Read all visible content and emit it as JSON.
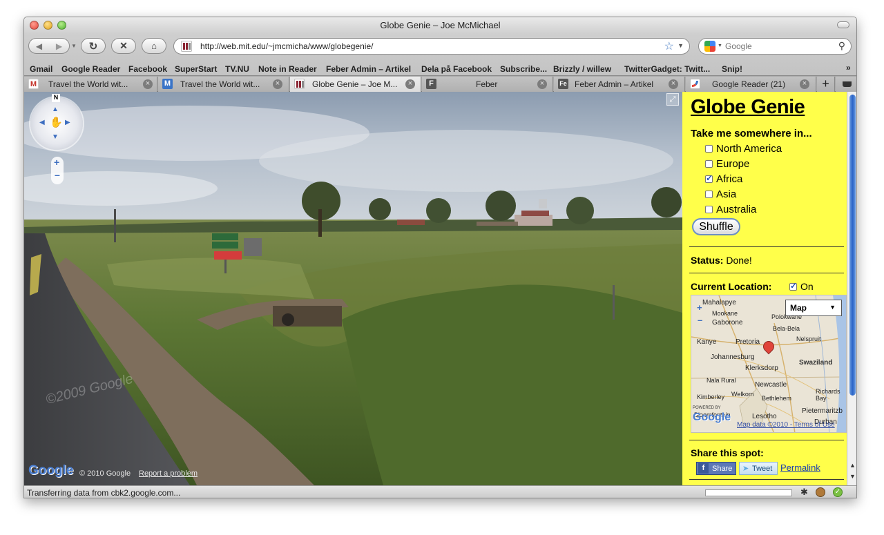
{
  "window": {
    "title": "Globe Genie – Joe McMichael"
  },
  "toolbar": {
    "url": "http://web.mit.edu/~jmcmicha/www/globegenie/",
    "search_placeholder": "Google"
  },
  "bookmarks": [
    "Gmail",
    "Google Reader",
    "Facebook",
    "SuperStart",
    "TV.NU",
    "Note in Reader",
    "Feber Admin – Artikel",
    "Dela på Facebook",
    "Subscribe...",
    "Brizzly / willew",
    "TwitterGadget: Twitt...",
    "Snip!"
  ],
  "tabs": [
    {
      "label": "Travel the World wit...",
      "icon": "gmail-icon",
      "icon_text": "M",
      "color": "#c5352c",
      "active": false
    },
    {
      "label": "Travel the World wit...",
      "icon": "gmail-icon",
      "icon_text": "M",
      "color": "#3a74c7",
      "active": false
    },
    {
      "label": "Globe Genie – Joe M...",
      "icon": "mit-icon",
      "icon_text": "",
      "color": "#8a2432",
      "active": true
    },
    {
      "label": "Feber",
      "icon": "feber-icon",
      "icon_text": "F",
      "color": "#555555",
      "active": false
    },
    {
      "label": "Feber Admin – Artikel",
      "icon": "feber-icon",
      "icon_text": "Fe",
      "color": "#555555",
      "active": false
    },
    {
      "label": "Google Reader (21)",
      "icon": "google-reader-icon",
      "icon_text": "",
      "color": "#3a74c7",
      "active": false
    }
  ],
  "streetview": {
    "copyright": "© 2010 Google",
    "report": "Report a problem",
    "watermark": "©2009 Google",
    "compass": "N",
    "logo": "Google"
  },
  "panel": {
    "title": "Globe Genie",
    "prompt": "Take me somewhere in...",
    "regions": [
      {
        "label": "North America",
        "checked": false
      },
      {
        "label": "Europe",
        "checked": false
      },
      {
        "label": "Africa",
        "checked": true
      },
      {
        "label": "Asia",
        "checked": false
      },
      {
        "label": "Australia",
        "checked": false
      }
    ],
    "shuffle": "Shuffle",
    "status_label": "Status:",
    "status_value": "Done!",
    "location_label": "Current Location:",
    "location_toggle": "On",
    "share_label": "Share this spot:",
    "share_button": "Share",
    "tweet_button": "Tweet",
    "permalink": "Permalink"
  },
  "minimap": {
    "type_select": "Map",
    "logo": "Google",
    "powered_by": "POWERED BY",
    "map_data": "Map data ©2010 - Terms of Use",
    "places": [
      "Mahalapye",
      "Mookane",
      "Gaborone",
      "Polokwane",
      "Bela-Bela",
      "Kanye",
      "Pretoria",
      "Nelspruit",
      "Johannesburg",
      "Swaziland",
      "Klerksdorp",
      "Newcastle",
      "Nala Rural",
      "Welkom",
      "Richards Bay",
      "Kimberley",
      "Bethlehem",
      "Lesotho",
      "Pietermaritzb",
      "Bloemfontein",
      "Durban"
    ]
  },
  "status": {
    "text": "Transferring data from cbk2.google.com..."
  },
  "colors": {
    "panel_bg": "#ffff4a",
    "link": "#1a3fb0"
  }
}
